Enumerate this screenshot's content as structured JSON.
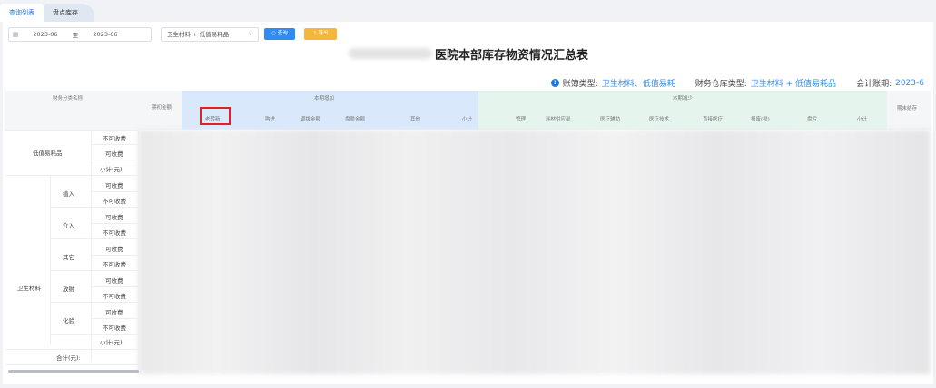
{
  "tabs": [
    {
      "label": "查询列表",
      "active": true
    },
    {
      "label": "盘点库存",
      "active": false
    }
  ],
  "toolbar": {
    "date_from": "2023-06",
    "date_sep": "至",
    "date_to": "2023-06",
    "ledger_select": "卫生材料 + 低值易耗品",
    "query_label": "查询",
    "export_label": "导出"
  },
  "title": "医院本部库存物资情况汇总表",
  "info": {
    "ledger_type_label": "账簿类型:",
    "ledger_type_value": "卫生材料、低值易耗",
    "warehouse_type_label": "财务仓库类型:",
    "warehouse_type_value": "卫生材料 + 低值易耗品",
    "period_label": "会计账期:",
    "period_value": "2023-6"
  },
  "table": {
    "col_category": "财务分类名称",
    "col_opening": "期初金额",
    "group_increase": "本期增加",
    "group_decrease": "本期减少",
    "col_closing": "期末结存",
    "increase_cols": [
      "老转新",
      "购进",
      "调拨金额",
      "盘盈金额",
      "其他",
      "小计"
    ],
    "decrease_cols": [
      "管理",
      "耗材供应部",
      "医疗辅助",
      "医疗技术",
      "直接医疗",
      "报废(损)",
      "盘亏",
      "小计"
    ],
    "rows": {
      "low_value": {
        "label": "低值易耗品",
        "items": [
          "不可收费",
          "可收费",
          "小计(元):"
        ]
      },
      "medical": {
        "label": "卫生材料",
        "groups": [
          {
            "label": "植入",
            "items": [
              "可收费",
              "不可收费"
            ]
          },
          {
            "label": "介入",
            "items": [
              "可收费",
              "不可收费"
            ]
          },
          {
            "label": "其它",
            "items": [
              "可收费",
              "不可收费"
            ]
          },
          {
            "label": "放射",
            "items": [
              "可收费",
              "不可收费"
            ]
          },
          {
            "label": "化验",
            "items": [
              "可收费",
              "不可收费"
            ]
          }
        ],
        "subtotal": "小计(元):"
      },
      "total": "合计(元):"
    }
  },
  "colors": {
    "accent": "#2f8cf5",
    "export": "#f6b63a",
    "highlight": "#e02020"
  }
}
